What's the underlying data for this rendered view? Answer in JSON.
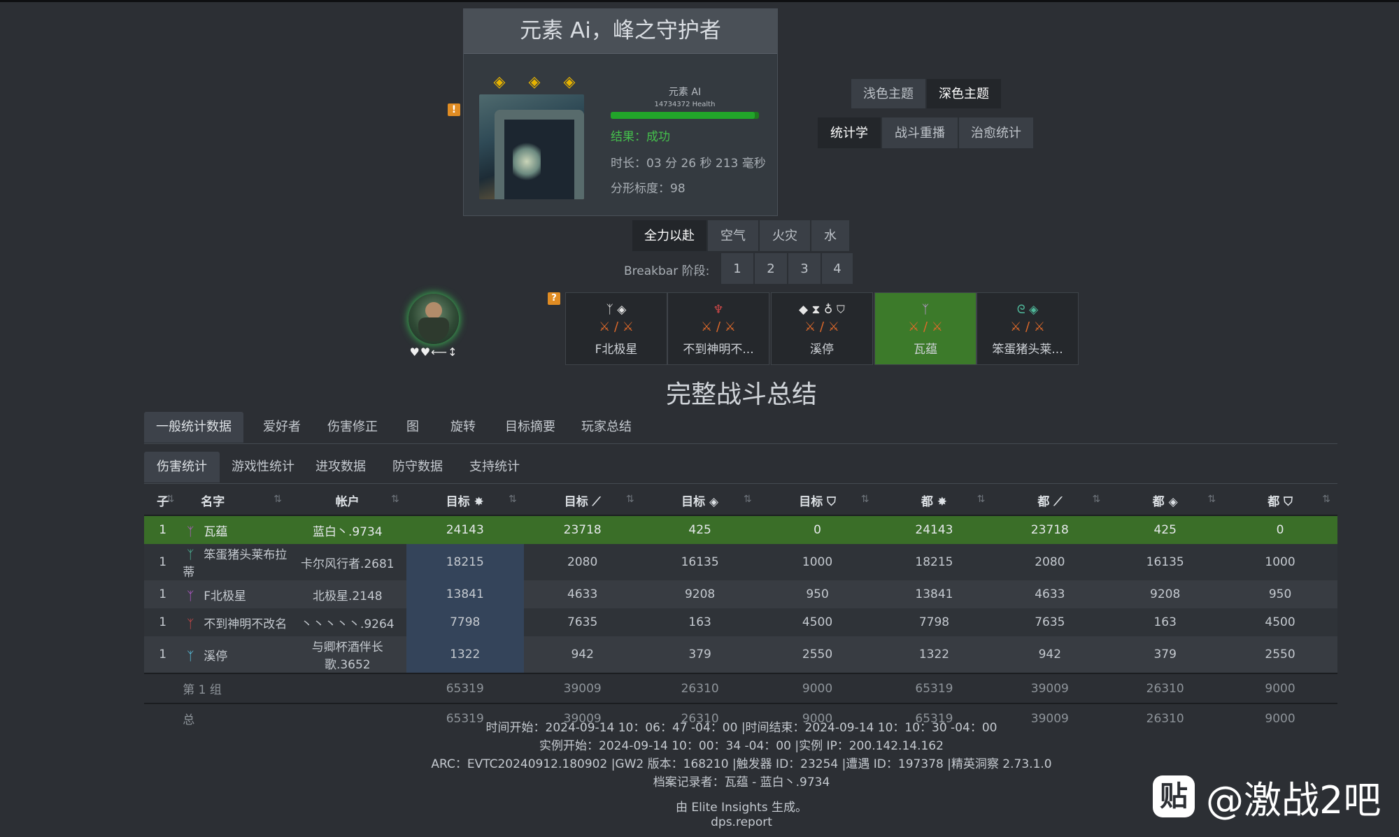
{
  "encounter": {
    "title": "元素 Ai，峰之守护者",
    "boss_name": "元素 AI",
    "boss_health": "14734372 Health",
    "health_fraction": 0.97,
    "result": "结果：成功",
    "duration": "时长：03 分 26 秒 213 毫秒",
    "fractal_scale": "分形标度：98",
    "status_icons": [
      "diamond-icon",
      "diamond-icon",
      "diamond-icon"
    ]
  },
  "theme": {
    "light": "浅色主题",
    "dark": "深色主题"
  },
  "mode": {
    "stats": "统计学",
    "replay": "战斗重播",
    "healing": "治愈统计"
  },
  "phases": [
    "全力以赴",
    "空气",
    "火灾",
    "水"
  ],
  "breakbar": {
    "label": "Breakbar 阶段:",
    "phases": [
      "1",
      "2",
      "3",
      "4"
    ]
  },
  "players": [
    {
      "name": "F北极星",
      "active": false
    },
    {
      "name": "不到神明不...",
      "active": false
    },
    {
      "name": "溪停",
      "active": false
    },
    {
      "name": "瓦蕴",
      "active": true
    },
    {
      "name": "笨蛋猪头莱...",
      "active": false
    }
  ],
  "section_title": "完整战斗总结",
  "tabs_main": [
    "一般统计数据",
    "爱好者",
    "伤害修正",
    "图",
    "旋转",
    "目标摘要",
    "玩家总结"
  ],
  "tabs_sub": [
    "伤害统计",
    "游戏性统计",
    "进攻数据",
    "防守数据",
    "支持统计"
  ],
  "table": {
    "headers": [
      "子",
      "名字",
      "帐户",
      "目标",
      "目标",
      "目标",
      "目标",
      "都",
      "都",
      "都",
      "都"
    ],
    "rows": [
      {
        "sub": "1",
        "name": "瓦蕴",
        "account": "蓝白丶.9734",
        "v": [
          "24143",
          "23718",
          "425",
          "0",
          "24143",
          "23718",
          "425",
          "0"
        ],
        "color": "#b85ad0"
      },
      {
        "sub": "1",
        "name": "笨蛋猪头莱布拉蒂",
        "account": "卡尔风行者.2681",
        "v": [
          "18215",
          "2080",
          "16135",
          "1000",
          "18215",
          "2080",
          "16135",
          "1000"
        ],
        "color": "#4fb89a"
      },
      {
        "sub": "1",
        "name": "F北极星",
        "account": "北极星.2148",
        "v": [
          "13841",
          "4633",
          "9208",
          "950",
          "13841",
          "4633",
          "9208",
          "950"
        ],
        "color": "#b85ad0"
      },
      {
        "sub": "1",
        "name": "不到神明不改名",
        "account": "丶丶丶丶丶.9264",
        "v": [
          "7798",
          "7635",
          "163",
          "4500",
          "7798",
          "7635",
          "163",
          "4500"
        ],
        "color": "#d04848"
      },
      {
        "sub": "1",
        "name": "溪停",
        "account": "与卿杯酒伴长歌.3652",
        "v": [
          "1322",
          "942",
          "379",
          "2550",
          "1322",
          "942",
          "379",
          "2550"
        ],
        "color": "#5ac8e8"
      }
    ],
    "group": {
      "label": "第 1 组",
      "v": [
        "65319",
        "39009",
        "26310",
        "9000",
        "65319",
        "39009",
        "26310",
        "9000"
      ]
    },
    "total": {
      "label": "总",
      "v": [
        "65319",
        "39009",
        "26310",
        "9000",
        "65319",
        "39009",
        "26310",
        "9000"
      ]
    }
  },
  "footer": {
    "line1": "时间开始：2024-09-14 10：06：47 -04：00 |时间结束：2024-09-14 10：10：30 -04：00",
    "line2": "实例开始：2024-09-14 10：00：34 -04：00 |实例 IP：200.142.14.162",
    "line3": "ARC：EVTC20240912.180902 |GW2 版本：168210 |触发器 ID：23254 |遭遇 ID：197378 |精英洞察 2.73.1.0",
    "line4": "档案记录者：瓦蕴 - 蓝白丶.9734",
    "line5": "由 Elite Insights 生成。",
    "line6": "dps.report"
  },
  "watermark": {
    "text": "@激战2吧",
    "icon": "贴"
  }
}
